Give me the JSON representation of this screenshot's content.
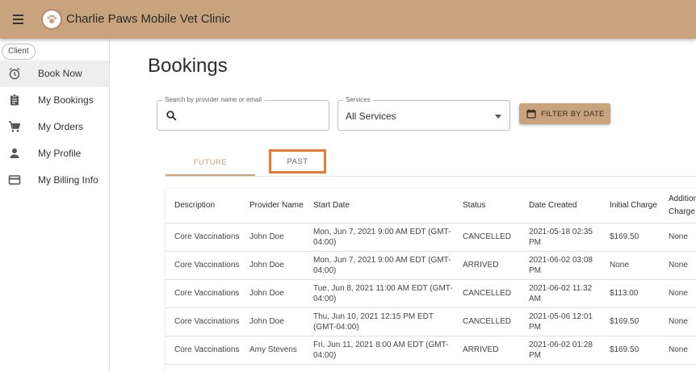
{
  "app": {
    "title": "Charlie Paws Mobile Vet Clinic"
  },
  "sidebar": {
    "role_chip": "Client",
    "items": [
      {
        "label": "Book Now",
        "icon": "alarm-clock-icon"
      },
      {
        "label": "My Bookings",
        "icon": "clipboard-icon"
      },
      {
        "label": "My Orders",
        "icon": "shopping-cart-icon"
      },
      {
        "label": "My Profile",
        "icon": "person-icon"
      },
      {
        "label": "My Billing Info",
        "icon": "credit-card-icon"
      }
    ]
  },
  "main": {
    "title": "Bookings",
    "search": {
      "legend": "Search by provider name or email",
      "value": ""
    },
    "services": {
      "legend": "Services",
      "selected": "All Services"
    },
    "filter_button": "FILTER BY DATE",
    "tabs": [
      {
        "label": "FUTURE"
      },
      {
        "label": "PAST"
      }
    ],
    "table": {
      "headers": [
        "Description",
        "Provider Name",
        "Start Date",
        "Status",
        "Date Created",
        "Initial Charge",
        "Additional Charge"
      ],
      "rows": [
        {
          "description": "Core Vaccinations",
          "provider": "John Doe",
          "start": "Mon, Jun 7, 2021 9:00 AM EDT (GMT-04:00)",
          "status": "CANCELLED",
          "created": "2021-05-18 02:35 PM",
          "initial": "$169.50",
          "additional": "None"
        },
        {
          "description": "Core Vaccinations",
          "provider": "John Doe",
          "start": "Mon, Jun 7, 2021 9:00 AM EDT (GMT-04:00)",
          "status": "ARRIVED",
          "created": "2021-06-02 03:08 PM",
          "initial": "None",
          "additional": "None"
        },
        {
          "description": "Core Vaccinations",
          "provider": "John Doe",
          "start": "Tue, Jun 8, 2021 11:00 AM EDT (GMT-04:00)",
          "status": "CANCELLED",
          "created": "2021-06-02 11:32 AM",
          "initial": "$113.00",
          "additional": "None"
        },
        {
          "description": "Core Vaccinations",
          "provider": "John Doe",
          "start": "Thu, Jun 10, 2021 12:15 PM EDT (GMT-04:00)",
          "status": "CANCELLED",
          "created": "2021-05-06 12:01 PM",
          "initial": "$169.50",
          "additional": "None"
        },
        {
          "description": "Core Vaccinations",
          "provider": "Amy Stevens",
          "start": "Fri, Jun 11, 2021 8:00 AM EDT (GMT-04:00)",
          "status": "ARRIVED",
          "created": "2021-06-02 01:28 PM",
          "initial": "$169.50",
          "additional": "None"
        }
      ]
    }
  },
  "colors": {
    "brand": "#c9a27e",
    "highlight": "#ee7a2e"
  }
}
